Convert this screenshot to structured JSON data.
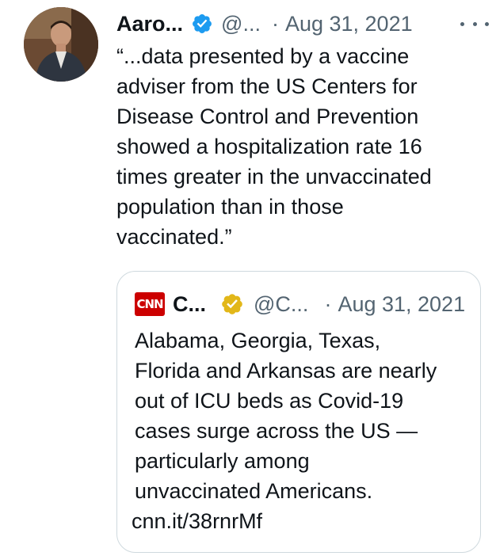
{
  "tweet": {
    "author_name": "Aaro...",
    "author_handle": "@...",
    "separator": "·",
    "date": "Aug 31, 2021",
    "text": "“...data presented by a vaccine\nadviser from the US Centers for\nDisease Control and Prevention\nshowed a hospitalization rate 16\ntimes greater in the unvaccinated\npopulation than in those\nvaccinated.”",
    "verified_badge_color": "#1d9bf0",
    "more_icon": "more-horizontal-icon"
  },
  "quoted_tweet": {
    "logo_text": "CNN",
    "logo_color": "#cc0000",
    "author_name": "C...",
    "author_handle": "@C...",
    "separator": "·",
    "date": "Aug 31, 2021",
    "text": "Alabama, Georgia, Texas,\nFlorida and Arkansas are nearly\nout of ICU beds as Covid-19\ncases surge across the US —\nparticularly among\nunvaccinated Americans.",
    "link": "cnn.it/38rnrMf",
    "verified_badge_color": "#e2b719"
  },
  "colors": {
    "text": "#0f1419",
    "secondary_text": "#536471",
    "border": "#cfd9de"
  }
}
